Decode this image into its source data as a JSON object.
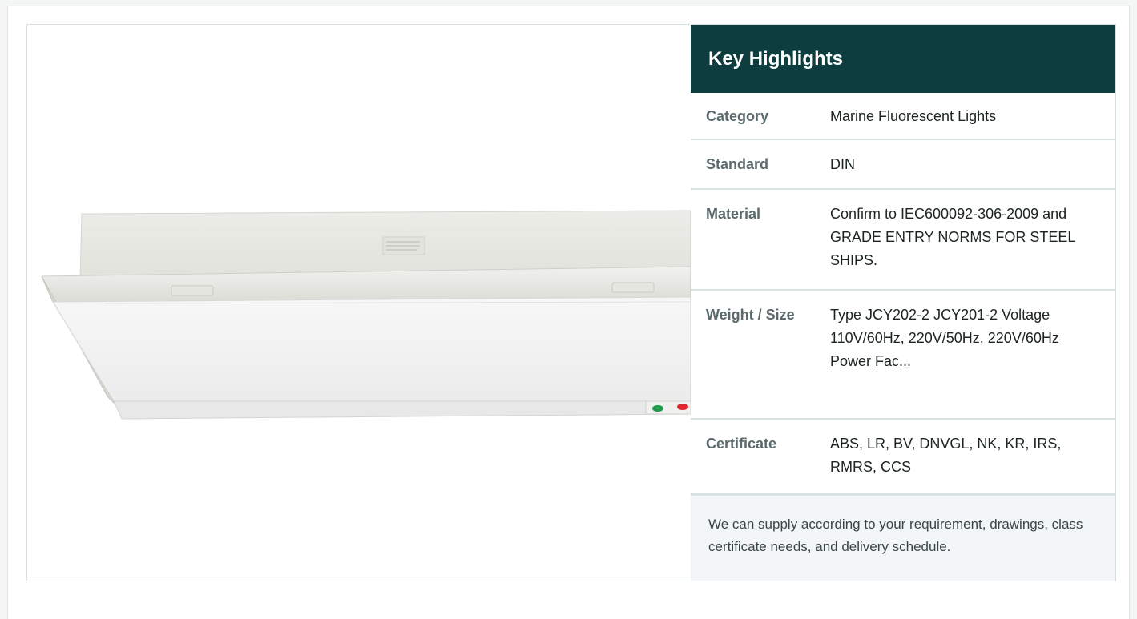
{
  "header": {
    "title": "Key Highlights"
  },
  "specs": [
    {
      "label": "Category",
      "value": "Marine Fluorescent Lights"
    },
    {
      "label": "Standard",
      "value": "DIN"
    },
    {
      "label": "Material",
      "value": "Confirm to IEC600092-306-2009 and GRADE ENTRY NORMS FOR STEEL SHIPS."
    },
    {
      "label": "Weight / Size",
      "value": "Type JCY202-2 JCY201-2 Voltage 110V/60Hz, 220V/50Hz, 220V/60Hz Power Fac..."
    },
    {
      "label": "Certificate",
      "value": "ABS, LR, BV, DNVGL, NK, KR, IRS, RMRS, CCS"
    }
  ],
  "note": "We can supply according to your requirement, drawings, class certificate needs, and delivery schedule.",
  "colors": {
    "header_bg": "#0d3d3f",
    "indicator_green": "#1e9a4a",
    "indicator_red": "#e0262e"
  },
  "image": {
    "subject": "marine-fluorescent-light-fixture"
  }
}
